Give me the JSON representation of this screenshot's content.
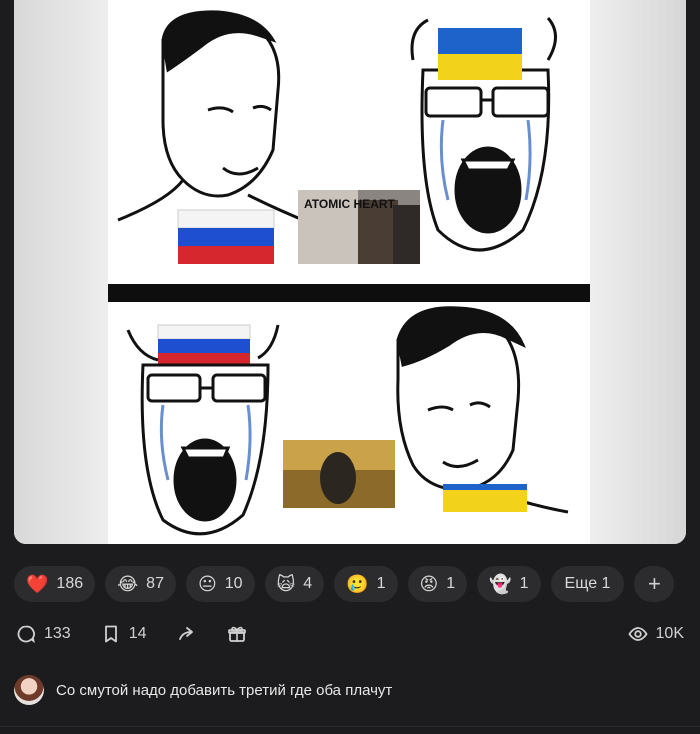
{
  "post": {
    "image_text": "ATOMIC HEART"
  },
  "reactions": [
    {
      "icon": "heart-emoji",
      "emoji": "❤️",
      "count": "186"
    },
    {
      "icon": "laughing-tears-emoji",
      "emoji": "😂",
      "count": "87"
    },
    {
      "icon": "neutral-face-emoji",
      "emoji": "😐",
      "count": "10"
    },
    {
      "icon": "scream-cat-emoji",
      "emoji": "🙀",
      "count": "4"
    },
    {
      "icon": "crying-face-emoji",
      "emoji": "🥲",
      "count": "1"
    },
    {
      "icon": "angry-face-emoji",
      "emoji": "😡",
      "count": "1"
    },
    {
      "icon": "ghost-sticker-emoji",
      "emoji": "👻",
      "count": "1"
    }
  ],
  "more_reactions": {
    "label": "Еще 1"
  },
  "add_reaction": {
    "label": "+"
  },
  "stats": {
    "comments": "133",
    "bookmarks": "14",
    "views": "10K"
  },
  "comment": {
    "text": "Со смутой надо добавить третий где оба плачут"
  },
  "colors": {
    "background": "#1c1c1e",
    "pill": "#2c2c2e",
    "text": "#d8d8d8"
  }
}
